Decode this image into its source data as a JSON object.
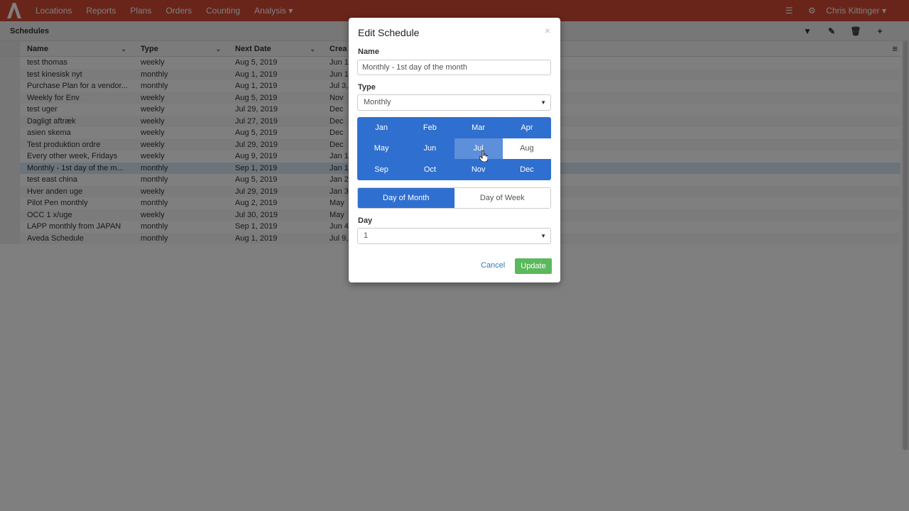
{
  "nav": {
    "items": [
      "Locations",
      "Reports",
      "Plans",
      "Orders",
      "Counting",
      "Analysis ▾"
    ],
    "user": "Chris Kittinger ▾"
  },
  "page": {
    "title": "Schedules"
  },
  "table": {
    "columns": [
      "Name",
      "Type",
      "Next Date",
      "Crea"
    ],
    "rows": [
      [
        "test thomas",
        "weekly",
        "Aug 5, 2019",
        "Jun 1"
      ],
      [
        "test kinesisk nyt",
        "monthly",
        "Aug 1, 2019",
        "Jun 1"
      ],
      [
        "Purchase Plan for a vendor...",
        "monthly",
        "Aug 1, 2019",
        "Jul 3,"
      ],
      [
        "Weekly for Env",
        "weekly",
        "Aug 5, 2019",
        "Nov"
      ],
      [
        "test uger",
        "weekly",
        "Jul 29, 2019",
        "Dec"
      ],
      [
        "Dagligt aftræk",
        "weekly",
        "Jul 27, 2019",
        "Dec"
      ],
      [
        "asien skema",
        "weekly",
        "Aug 5, 2019",
        "Dec"
      ],
      [
        "Test produktion ordre",
        "weekly",
        "Jul 29, 2019",
        "Dec"
      ],
      [
        "Every other week, Fridays",
        "weekly",
        "Aug 9, 2019",
        "Jan 1"
      ],
      [
        "Monthly - 1st day of the m...",
        "monthly",
        "Sep 1, 2019",
        "Jan 1"
      ],
      [
        "test east china",
        "monthly",
        "Aug 5, 2019",
        "Jan 2"
      ],
      [
        "Hver anden uge",
        "weekly",
        "Jul 29, 2019",
        "Jan 3"
      ],
      [
        "Pilot Pen monthly",
        "monthly",
        "Aug 2, 2019",
        "May"
      ],
      [
        "OCC 1 x/uge",
        "weekly",
        "Jul 30, 2019",
        "May"
      ],
      [
        "LAPP monthly from JAPAN",
        "monthly",
        "Sep 1, 2019",
        "Jun 4"
      ],
      [
        "Aveda Schedule",
        "monthly",
        "Aug 1, 2019",
        "Jul 9,"
      ]
    ],
    "selected_index": 9
  },
  "modal": {
    "title": "Edit Schedule",
    "close": "×",
    "name_label": "Name",
    "name_value": "Monthly - 1st day of the month",
    "type_label": "Type",
    "type_value": "Monthly",
    "months": [
      "Jan",
      "Feb",
      "Mar",
      "Apr",
      "May",
      "Jun",
      "Jul",
      "Aug",
      "Sep",
      "Oct",
      "Nov",
      "Dec"
    ],
    "day_of_month": "Day of Month",
    "day_of_week": "Day of Week",
    "day_label": "Day",
    "day_value": "1",
    "cancel": "Cancel",
    "update": "Update"
  },
  "colors": {
    "nav": "#d24a35",
    "primary": "#2f6fcf",
    "success": "#5cb85c"
  }
}
